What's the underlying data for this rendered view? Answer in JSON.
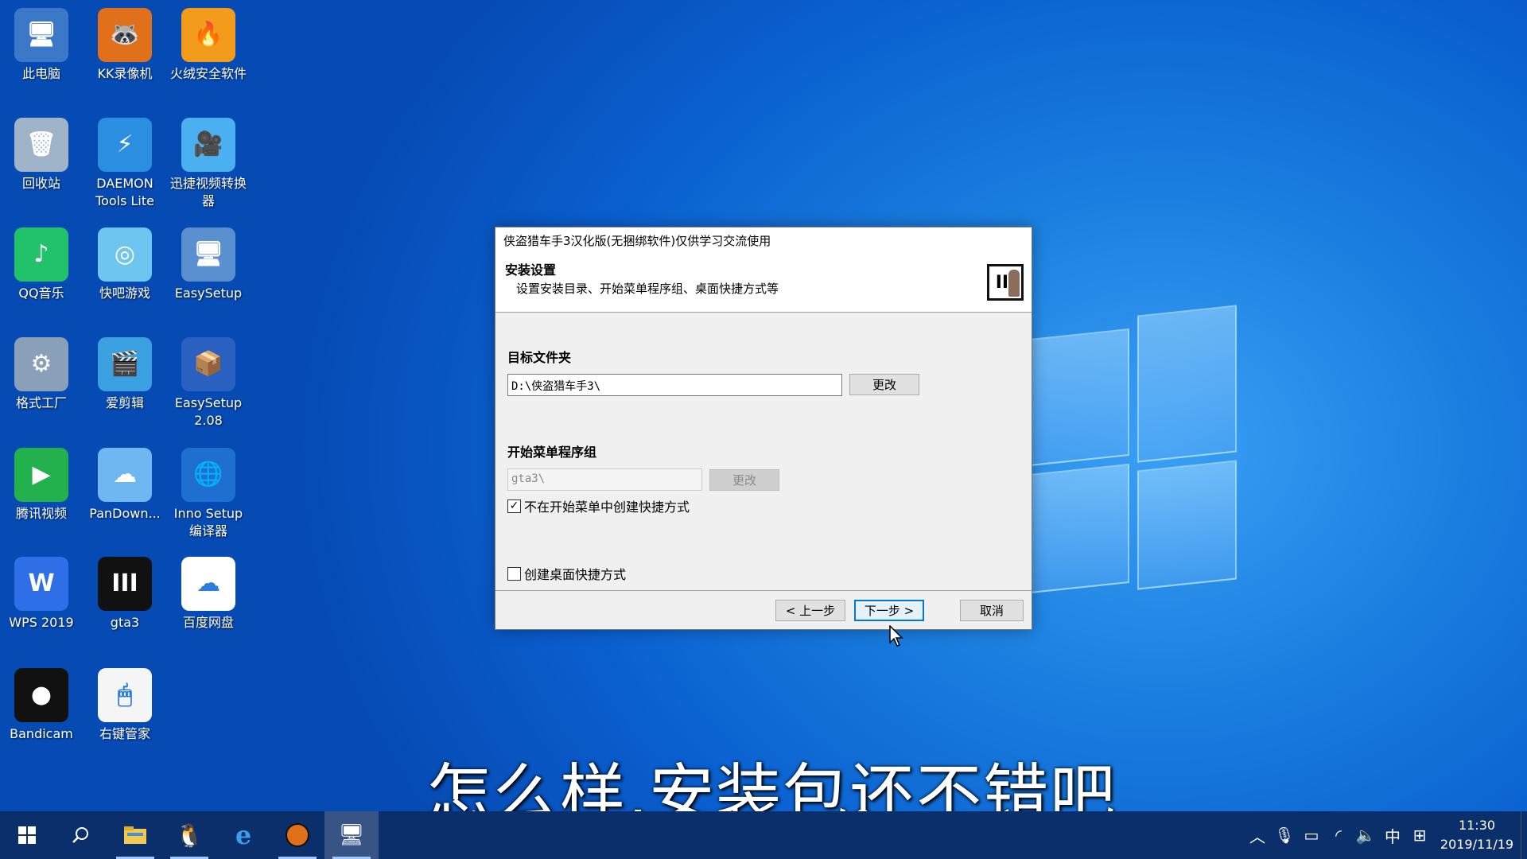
{
  "desktop": {
    "icons": [
      {
        "label": "此电脑",
        "glyph": "🖥",
        "color": "#3c78c8",
        "icon": "computer-icon"
      },
      {
        "label": "KK录像机",
        "glyph": "🦝",
        "color": "#e0701a",
        "icon": "kk-recorder-icon"
      },
      {
        "label": "火绒安全软件",
        "glyph": "🔥",
        "color": "#f39c1c",
        "icon": "huorong-shield-icon"
      },
      {
        "label": "回收站",
        "glyph": "🗑",
        "color": "#9fb4c8",
        "icon": "recycle-bin-icon"
      },
      {
        "label": "DAEMON Tools Lite",
        "glyph": "⚡",
        "color": "#2a8fe0",
        "icon": "daemon-tools-icon"
      },
      {
        "label": "迅捷视频转换器",
        "glyph": "🎥",
        "color": "#4ab0f0",
        "icon": "video-converter-icon"
      },
      {
        "label": "QQ音乐",
        "glyph": "♪",
        "color": "#21c26a",
        "icon": "qq-music-icon"
      },
      {
        "label": "快吧游戏",
        "glyph": "◎",
        "color": "#6ec6f0",
        "icon": "kuaiba-game-icon"
      },
      {
        "label": "EasySetup",
        "glyph": "🖥",
        "color": "#5a8fd0",
        "icon": "easysetup-icon"
      },
      {
        "label": "格式工厂",
        "glyph": "⚙",
        "color": "#8aa0b8",
        "icon": "format-factory-icon"
      },
      {
        "label": "爱剪辑",
        "glyph": "🎬",
        "color": "#3aa0e0",
        "icon": "aijianji-icon"
      },
      {
        "label": "EasySetup 2.08",
        "glyph": "📦",
        "color": "#2a60c0",
        "icon": "easysetup-installer-icon"
      },
      {
        "label": "腾讯视频",
        "glyph": "▶",
        "color": "#23b14d",
        "icon": "tencent-video-icon"
      },
      {
        "label": "PanDown...",
        "glyph": "☁",
        "color": "#6fb7f0",
        "icon": "pandownload-icon"
      },
      {
        "label": "Inno Setup 编译器",
        "glyph": "🌐",
        "color": "#1f6fd0",
        "icon": "inno-setup-icon"
      },
      {
        "label": "WPS 2019",
        "glyph": "W",
        "color": "#2e6fe8",
        "icon": "wps-icon"
      },
      {
        "label": "gta3",
        "glyph": "III",
        "color": "#111111",
        "icon": "gta3-icon"
      },
      {
        "label": "百度网盘",
        "glyph": "☁",
        "color": "#ffffff",
        "icon": "baidu-netdisk-icon"
      },
      {
        "label": "Bandicam",
        "glyph": "●",
        "color": "#111111",
        "icon": "bandicam-icon"
      },
      {
        "label": "右键管家",
        "glyph": "🖱",
        "color": "#f5f5f5",
        "icon": "right-click-manager-icon"
      }
    ]
  },
  "dialog": {
    "title": "侠盗猎车手3汉化版(无捆绑软件)仅供学习交流使用",
    "header_title": "安装设置",
    "header_subtitle": "设置安装目录、开始菜单程序组、桌面快捷方式等",
    "logo_text": "III",
    "target_label": "目标文件夹",
    "target_value": "D:\\侠盗猎车手3\\",
    "change_label": "更改",
    "startmenu_label": "开始菜单程序组",
    "startmenu_value": "gta3\\",
    "startmenu_change_label": "更改",
    "no_startmenu_label": "不在开始菜单中创建快捷方式",
    "no_startmenu_checked": true,
    "desktop_shortcut_label": "创建桌面快捷方式",
    "desktop_shortcut_checked": false,
    "back_label": "< 上一步",
    "next_label": "下一步 >",
    "cancel_label": "取消"
  },
  "subtitle": "怎么样,安装包还不错吧",
  "taskbar": {
    "ime": "中",
    "time": "11:30",
    "date": "2019/11/19"
  }
}
